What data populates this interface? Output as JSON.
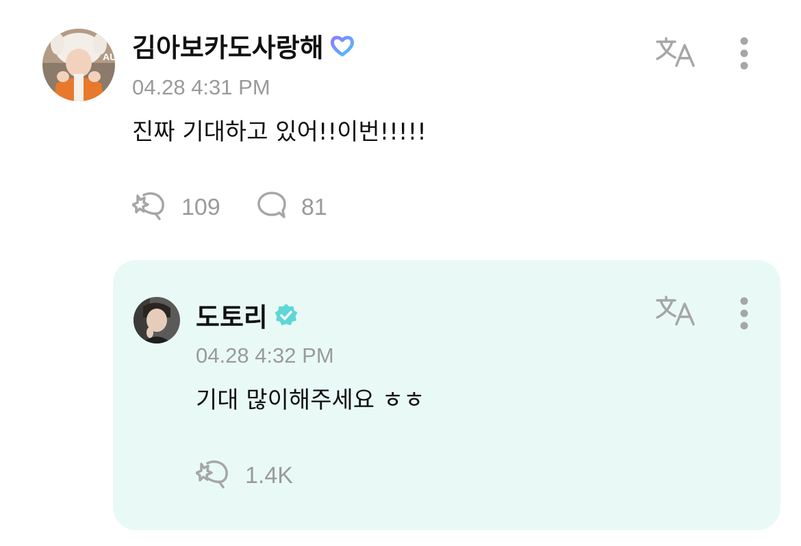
{
  "comment": {
    "username": "김아보카도사랑해",
    "badge_icon": "heart-outline-icon",
    "timestamp": "04.28 4:31 PM",
    "text": "진짜 기대하고 있어!!이번!!!!!",
    "likes": "109",
    "replies": "81",
    "translate_icon": "translate-icon",
    "more_icon": "more-vertical-icon"
  },
  "reply": {
    "username": "도토리",
    "badge_icon": "verified-badge-icon",
    "timestamp": "04.28 4:32 PM",
    "text": "기대 많이해주세요 ㅎㅎ",
    "likes": "1.4K",
    "translate_icon": "translate-icon",
    "more_icon": "more-vertical-icon"
  },
  "colors": {
    "reply_background": "#e9faf6",
    "verified_badge": "#5fd6d6",
    "heart_gradient_start": "#8a7bff",
    "heart_gradient_end": "#4fc3f7",
    "muted_text": "#9a9a9a"
  }
}
